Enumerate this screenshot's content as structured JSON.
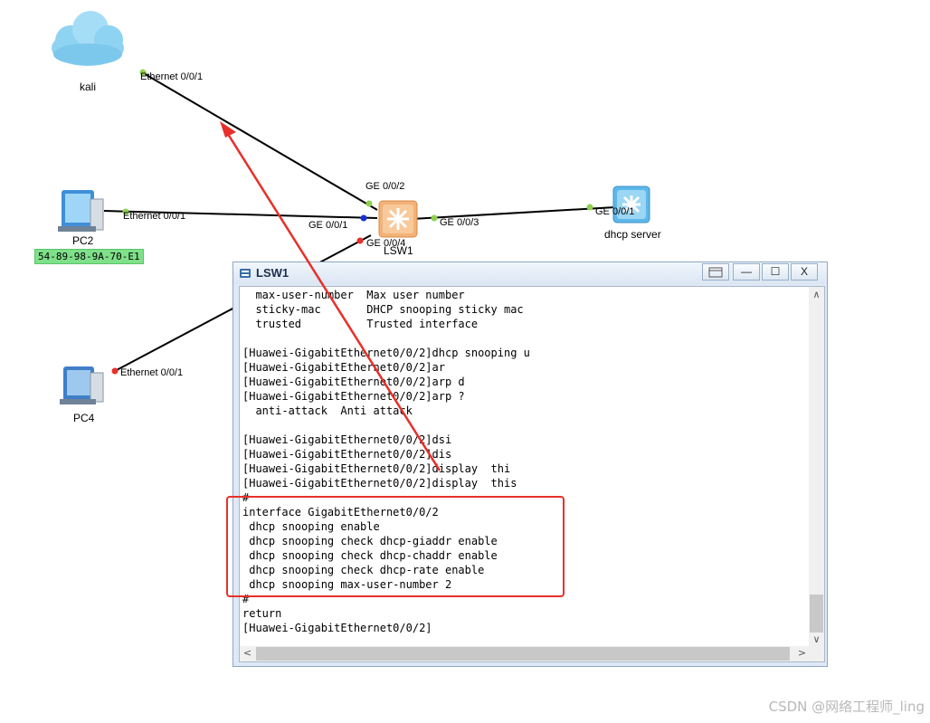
{
  "devices": {
    "kali": "kali",
    "pc2": "PC2",
    "pc4": "PC4",
    "lsw1": "LSW1",
    "dhcp_server": "dhcp server"
  },
  "pc2_mac": "54-89-98-9A-70-E1",
  "ports": {
    "kali_eth": "Ethernet 0/0/1",
    "pc2_eth": "Ethernet 0/0/1",
    "pc4_eth": "Ethernet 0/0/1",
    "sw_ge1": "GE 0/0/1",
    "sw_ge2": "GE 0/0/2",
    "sw_ge3": "GE 0/0/3",
    "sw_ge4": "GE 0/0/4",
    "dhcp_ge1": "GE 0/0/1"
  },
  "window": {
    "title": "LSW1",
    "buttons": {
      "minimize": "—",
      "maximize": "☐",
      "close": "X"
    }
  },
  "terminal_lines": [
    "  max-user-number  Max user number",
    "  sticky-mac       DHCP snooping sticky mac",
    "  trusted          Trusted interface",
    "",
    "[Huawei-GigabitEthernet0/0/2]dhcp snooping u",
    "[Huawei-GigabitEthernet0/0/2]ar",
    "[Huawei-GigabitEthernet0/0/2]arp d",
    "[Huawei-GigabitEthernet0/0/2]arp ?",
    "  anti-attack  Anti attack",
    "",
    "[Huawei-GigabitEthernet0/0/2]dsi",
    "[Huawei-GigabitEthernet0/0/2]dis",
    "[Huawei-GigabitEthernet0/0/2]display  thi",
    "[Huawei-GigabitEthernet0/0/2]display  this",
    "#",
    "interface GigabitEthernet0/0/2",
    " dhcp snooping enable",
    " dhcp snooping check dhcp-giaddr enable",
    " dhcp snooping check dhcp-chaddr enable",
    " dhcp snooping check dhcp-rate enable",
    " dhcp snooping max-user-number 2",
    "#",
    "return",
    "[Huawei-GigabitEthernet0/0/2]"
  ],
  "watermark": "CSDN @网络工程师_ling",
  "colors": {
    "link_up": "#8fd14f",
    "link_down": "#e8302a",
    "link_blue": "#1a2fd6",
    "annotation": "#e8302a",
    "mac_badge": "#7fe08a"
  },
  "icons": {
    "kali": "cloud-icon",
    "pc2": "pc-icon",
    "pc4": "pc-icon",
    "lsw1": "switch-icon",
    "dhcp_server": "server-icon"
  }
}
